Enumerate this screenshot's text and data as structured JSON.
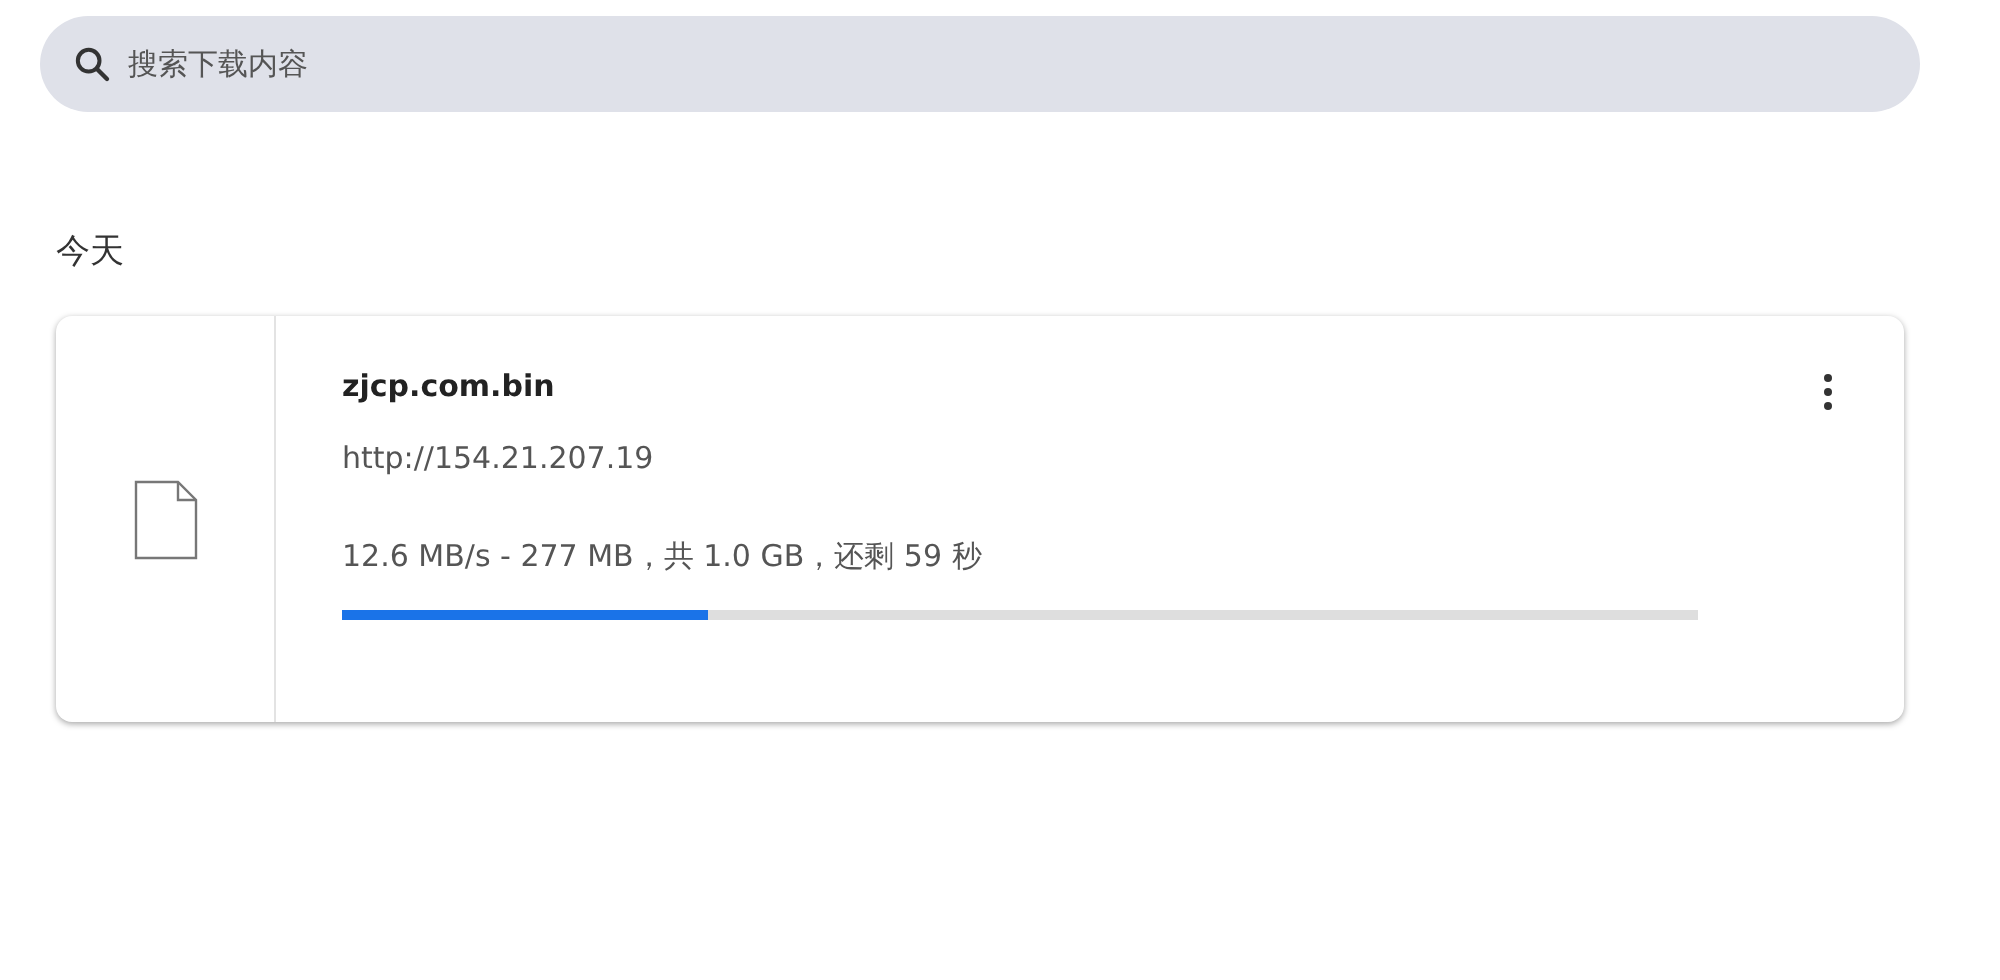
{
  "search": {
    "placeholder": "搜索下载内容"
  },
  "groups": [
    {
      "date": "今天",
      "downloads": [
        {
          "name": "zjcp.com.bin",
          "url": "http://154.21.207.19",
          "status": "12.6 MB/s - 277 MB，共 1.0 GB，还剩 59 秒",
          "level": 0.27
        }
      ]
    }
  ]
}
